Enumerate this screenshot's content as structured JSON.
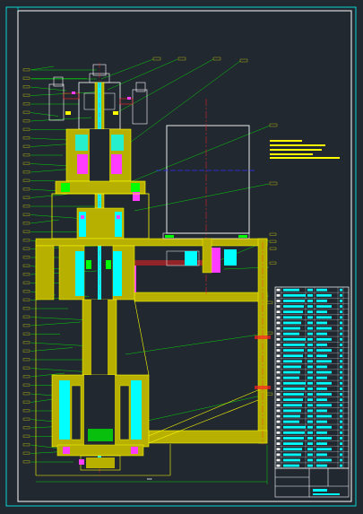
{
  "colors": {
    "background": "#212830",
    "frame": "#ffffff",
    "outline": "#ffff00",
    "section_fill": "#b8b000",
    "cyan": "#00ffff",
    "magenta": "#ff3cff",
    "green": "#00ff00",
    "red": "#ff2020",
    "blue": "#3030ff",
    "white": "#ffffff"
  },
  "labels": {
    "dimension_bottom": "840"
  },
  "parts_list": {
    "rows": 33,
    "columns": 6
  },
  "title_block": {
    "cells": 4
  }
}
